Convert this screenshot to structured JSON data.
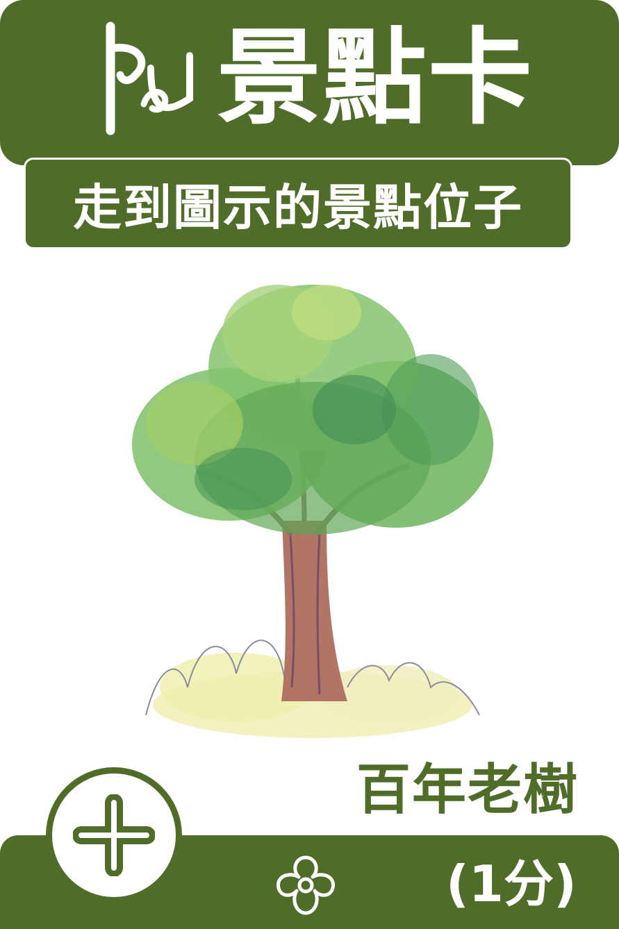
{
  "card": {
    "title": "景點卡",
    "instruction": "走到圖示的景點位子",
    "place_name": "百年老樹",
    "points": "(1分)",
    "action_icon": "plus-icon",
    "reward_icon": "flower-icon",
    "logo_icon": "footprint-logo-icon",
    "illustration": "tree-illustration"
  },
  "colors": {
    "primary": "#4f6d29",
    "text_on_primary": "#ffffff",
    "background": "#ffffff"
  }
}
